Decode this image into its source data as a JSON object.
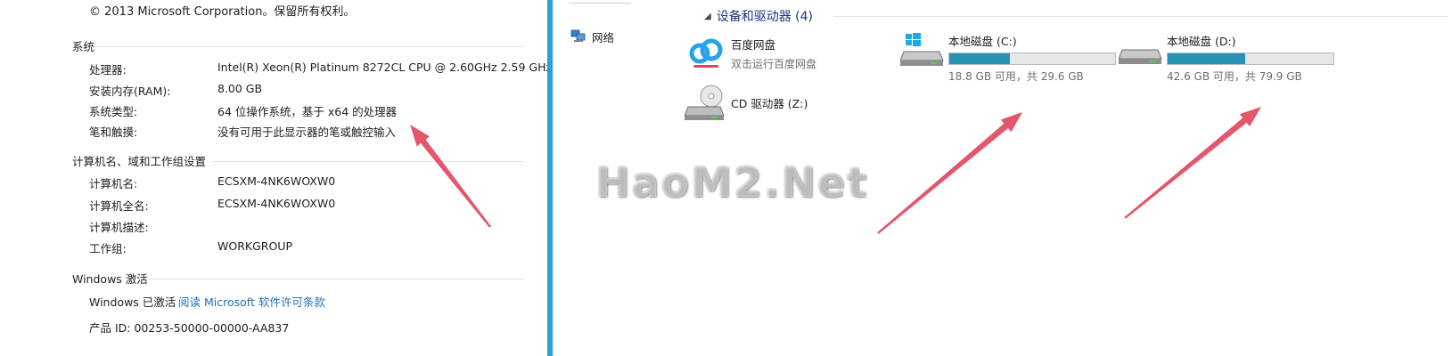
{
  "system_props": {
    "copyright": "© 2013 Microsoft Corporation。保留所有权利。",
    "system": {
      "title": "系统",
      "rows": [
        {
          "label": "处理器:",
          "value": "Intel(R) Xeon(R) Platinum 8272CL CPU @ 2.60GHz   2.59 GHz"
        },
        {
          "label": "安装内存(RAM):",
          "value": "8.00 GB"
        },
        {
          "label": "系统类型:",
          "value": "64 位操作系统，基于 x64 的处理器"
        },
        {
          "label": "笔和触摸:",
          "value": "没有可用于此显示器的笔或触控输入"
        }
      ]
    },
    "computer": {
      "title": "计算机名、域和工作组设置",
      "rows": [
        {
          "label": "计算机名:",
          "value": "ECSXM-4NK6WOXW0"
        },
        {
          "label": "计算机全名:",
          "value": "ECSXM-4NK6WOXW0"
        },
        {
          "label": "计算机描述:",
          "value": ""
        },
        {
          "label": "工作组:",
          "value": "WORKGROUP"
        }
      ]
    },
    "activation": {
      "title": "Windows 激活",
      "status": "Windows 已激活",
      "link": "阅读 Microsoft 软件许可条款",
      "product_id": "产品 ID: 00253-50000-00000-AA837"
    }
  },
  "explorer": {
    "nav": {
      "network_label": "网络",
      "network_icon": "network-icon"
    },
    "group_title": "设备和驱动器 (4)",
    "baidu": {
      "name": "百度网盘",
      "sub": "双击运行百度网盘",
      "icon": "baidu-cloud-icon"
    },
    "cd": {
      "name": "CD 驱动器 (Z:)",
      "icon": "cd-drive-icon"
    },
    "drives": [
      {
        "name": "本地磁盘 (C:)",
        "space": "18.8 GB 可用，共 29.6 GB",
        "used_fraction": 0.365,
        "icon": "windows-drive-icon"
      },
      {
        "name": "本地磁盘 (D:)",
        "space": "42.6 GB 可用，共 79.9 GB",
        "used_fraction": 0.467,
        "icon": "hard-drive-icon"
      }
    ],
    "bar_color": "#2693b5"
  },
  "watermark": "HaoM2.Net",
  "annotation_color": "#e0445c"
}
